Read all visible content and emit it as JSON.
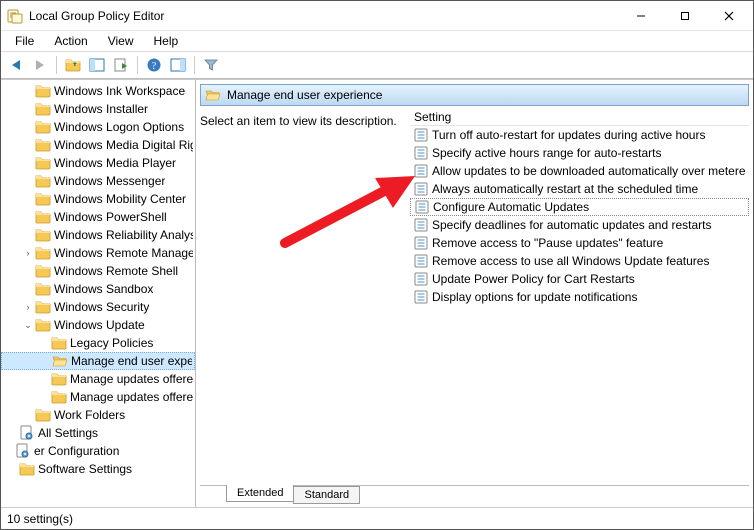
{
  "window": {
    "title": "Local Group Policy Editor"
  },
  "menu": {
    "items": [
      "File",
      "Action",
      "View",
      "Help"
    ]
  },
  "tree": {
    "items": [
      {
        "label": "Windows Ink Workspace",
        "depth": 1,
        "disclosure": ""
      },
      {
        "label": "Windows Installer",
        "depth": 1,
        "disclosure": ""
      },
      {
        "label": "Windows Logon Options",
        "depth": 1,
        "disclosure": ""
      },
      {
        "label": "Windows Media Digital Rights",
        "depth": 1,
        "disclosure": ""
      },
      {
        "label": "Windows Media Player",
        "depth": 1,
        "disclosure": ""
      },
      {
        "label": "Windows Messenger",
        "depth": 1,
        "disclosure": ""
      },
      {
        "label": "Windows Mobility Center",
        "depth": 1,
        "disclosure": ""
      },
      {
        "label": "Windows PowerShell",
        "depth": 1,
        "disclosure": ""
      },
      {
        "label": "Windows Reliability Analysis",
        "depth": 1,
        "disclosure": ""
      },
      {
        "label": "Windows Remote Management",
        "depth": 1,
        "disclosure": "›"
      },
      {
        "label": "Windows Remote Shell",
        "depth": 1,
        "disclosure": ""
      },
      {
        "label": "Windows Sandbox",
        "depth": 1,
        "disclosure": ""
      },
      {
        "label": "Windows Security",
        "depth": 1,
        "disclosure": "›"
      },
      {
        "label": "Windows Update",
        "depth": 1,
        "disclosure": "⌄"
      },
      {
        "label": "Legacy Policies",
        "depth": 2,
        "disclosure": ""
      },
      {
        "label": "Manage end user experience",
        "depth": 2,
        "disclosure": "",
        "selected": true
      },
      {
        "label": "Manage updates offered",
        "depth": 2,
        "disclosure": ""
      },
      {
        "label": "Manage updates offered",
        "depth": 2,
        "disclosure": ""
      },
      {
        "label": "Work Folders",
        "depth": 1,
        "disclosure": ""
      },
      {
        "label": "All Settings",
        "depth": 0,
        "disclosure": "",
        "icon": "gear"
      },
      {
        "label": "er Configuration",
        "depth": -1,
        "disclosure": "",
        "icon": "gear"
      },
      {
        "label": "Software Settings",
        "depth": 0,
        "disclosure": ""
      }
    ]
  },
  "content": {
    "header_title": "Manage end user experience",
    "hint": "Select an item to view its description.",
    "settings_header": "Setting",
    "settings": [
      "Turn off auto-restart for updates during active hours",
      "Specify active hours range for auto-restarts",
      "Allow updates to be downloaded automatically over metere",
      "Always automatically restart at the scheduled time",
      "Configure Automatic Updates",
      "Specify deadlines for automatic updates and restarts",
      "Remove access to \"Pause updates\" feature",
      "Remove access to use all Windows Update features",
      "Update Power Policy for Cart Restarts",
      "Display options for update notifications"
    ],
    "focused_index": 4
  },
  "tabs": {
    "extended": "Extended",
    "standard": "Standard",
    "active": "extended"
  },
  "status": {
    "text": "10 setting(s)"
  }
}
